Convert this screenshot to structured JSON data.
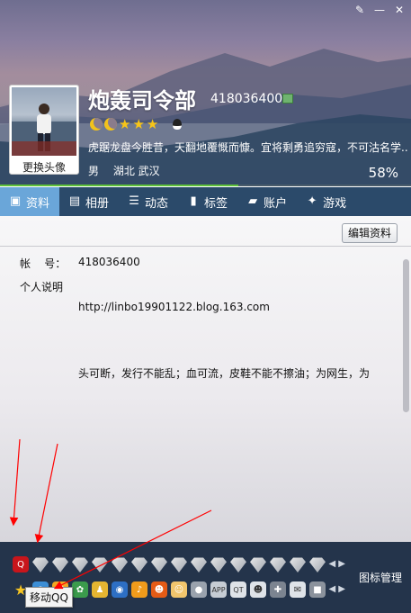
{
  "window": {
    "controls": [
      "skin-icon",
      "minimize-icon",
      "close-icon"
    ]
  },
  "profile": {
    "nickname": "炮轰司令部",
    "qq_number": "418036400",
    "avatar_caption": "更换头像",
    "signature": "虎踞龙盘今胜昔，天翻地覆慨而慷。宜将剩勇追穷寇，不可沽名学...",
    "gender": "男",
    "location": "湖北 武汉",
    "completion": "58%",
    "completion_fraction": 0.58,
    "level": {
      "moons": 2,
      "stars": 3
    }
  },
  "tabs": [
    {
      "label": "资料",
      "icon": "profile-card-icon",
      "active": true
    },
    {
      "label": "相册",
      "icon": "photo-album-icon",
      "active": false
    },
    {
      "label": "动态",
      "icon": "feed-list-icon",
      "active": false
    },
    {
      "label": "标签",
      "icon": "bookmark-icon",
      "active": false
    },
    {
      "label": "账户",
      "icon": "wallet-icon",
      "active": false
    },
    {
      "label": "游戏",
      "icon": "game-icon",
      "active": false
    }
  ],
  "details": {
    "edit_button": "编辑资料",
    "account_label": "帐    号：",
    "account_value": "418036400",
    "bio_label": "个人说明",
    "bio_link": "http://linbo19901122.blog.163.com",
    "bio_text": "头可断，发行不能乱；血可流，皮鞋不能不擦油；为网生，为"
  },
  "icon_bar": {
    "manage_label": "图标管理",
    "tooltip": "移动QQ",
    "pager_symbols": "◀ ▶",
    "colors": {
      "bar": "#24344b",
      "progress": "#5fc33b",
      "active_tab": "#6aa6d9",
      "arrow": "#ff0000"
    }
  }
}
